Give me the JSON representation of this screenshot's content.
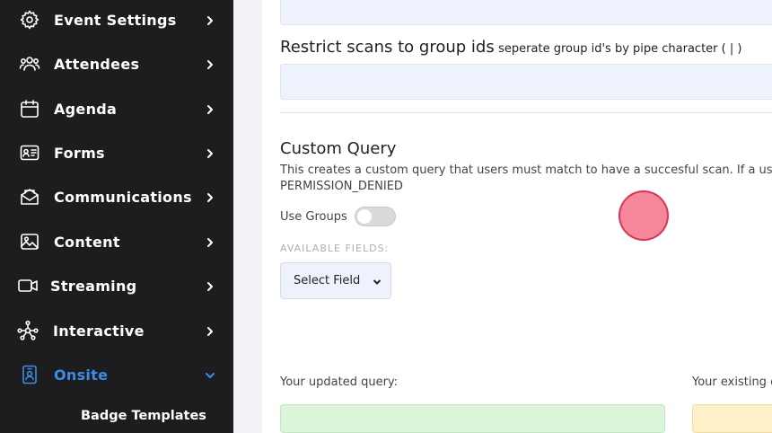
{
  "sidebar": {
    "items": [
      {
        "label": "Event Settings",
        "icon": "gear-icon"
      },
      {
        "label": "Attendees",
        "icon": "users-icon"
      },
      {
        "label": "Agenda",
        "icon": "calendar-icon"
      },
      {
        "label": "Forms",
        "icon": "id-card-icon"
      },
      {
        "label": "Communications",
        "icon": "mail-icon"
      },
      {
        "label": "Content",
        "icon": "image-icon"
      },
      {
        "label": "Streaming",
        "icon": "video-icon"
      },
      {
        "label": "Interactive",
        "icon": "network-icon"
      },
      {
        "label": "Onsite",
        "icon": "badge-icon"
      }
    ],
    "sub_items": [
      {
        "label": "Badge Templates"
      }
    ],
    "active_color": "#3a8ee6"
  },
  "main": {
    "restrict": {
      "title": "Restrict scans to group ids",
      "hint": "seperate group id's by pipe character ( | )"
    },
    "custom_query": {
      "title": "Custom Query",
      "description_line1": "This creates a custom query that users must match to have a succesful scan. If a user scan",
      "description_line2": "PERMISSION_DENIED",
      "use_groups_label": "Use Groups",
      "use_groups_enabled": false,
      "available_fields_label": "AVAILABLE FIELDS:",
      "select_value": "Select Field"
    },
    "updated_query_label": "Your updated query:",
    "existing_query_label": "Your existing qu"
  }
}
